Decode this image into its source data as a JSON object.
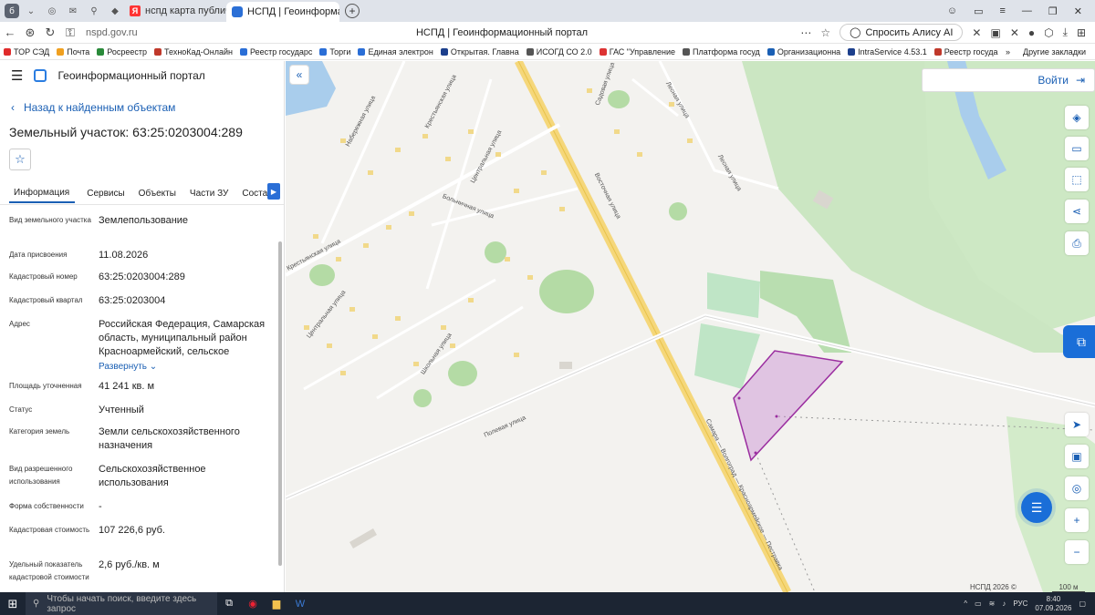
{
  "browser": {
    "tabs": [
      {
        "label": "нспд карта публичная кад",
        "icon": "yandex-icon"
      },
      {
        "label": "НСПД | Геоинформацио",
        "icon": "portal-icon"
      }
    ],
    "url": "nspd.gov.ru",
    "page_title": "НСПД | Геоинформационный портал",
    "alice_label": "Спросить Алису AI",
    "bookmarks": [
      "ТОР СЭД",
      "Почта",
      "Росреестр",
      "ТехноКад-Онлайн",
      "Реестр государс",
      "Торги",
      "Единая электрон",
      "Открытая. Главна",
      "ИСОГД СО 2.0",
      "ГАС \"Управление",
      "Платформа госуд",
      "Организационна",
      "IntraService 4.53.1",
      "Реестр госуда"
    ],
    "bookmarks_more": "Другие закладки"
  },
  "portal": {
    "name": "Геоинформационный портал",
    "back_label": "Назад к найденным объектам",
    "title": "Земельный участок: 63:25:0203004:289",
    "tabs": [
      "Информация",
      "Сервисы",
      "Объекты",
      "Части ЗУ",
      "Состав"
    ],
    "info": [
      {
        "label": "Вид земельного участка",
        "value": "Землепользование"
      },
      {
        "label": "Дата присвоения",
        "value": "11.08.2026"
      },
      {
        "label": "Кадастровый номер",
        "value": "63:25:0203004:289"
      },
      {
        "label": "Кадастровый квартал",
        "value": "63:25:0203004"
      },
      {
        "label": "Адрес",
        "value": "Российская Федерация, Самарская область, муниципальный район Красноармейский, сельское"
      },
      {
        "label": "Площадь уточненная",
        "value": "41 241 кв. м"
      },
      {
        "label": "Статус",
        "value": "Учтенный"
      },
      {
        "label": "Категория земель",
        "value": "Земли сельскохозяйственного назначения"
      },
      {
        "label": "Вид разрешенного использования",
        "value": "Сельскохозяйственное использования"
      },
      {
        "label": "Форма собственности",
        "value": "-"
      },
      {
        "label": "Кадастровая стоимость",
        "value": "107 226,6 руб."
      },
      {
        "label": "Удельный показатель кадастровой стоимости",
        "value": "2,6 руб./кв. м"
      }
    ],
    "expand_label": "Развернуть"
  },
  "map": {
    "login_label": "Войти",
    "credit": "НСПД 2026 ©",
    "scale": "100 м",
    "streets": [
      "Набережная улица",
      "Крестьянская улица",
      "Центральная улица",
      "Больничная улица",
      "Садовая улица",
      "Лесная улица",
      "Восточная улица",
      "Лесная улица",
      "Крестьянская улица",
      "Центральная улица",
      "Школьная улица",
      "Полевая улица",
      "Самара — Волгоград — Красноармейское — Пестравка"
    ],
    "parcel_color": "#9b2ea0"
  },
  "taskbar": {
    "search_placeholder": "Чтобы начать поиск, введите здесь запрос",
    "lang": "РУС",
    "time": "8:40",
    "date": "07.09.2026"
  }
}
